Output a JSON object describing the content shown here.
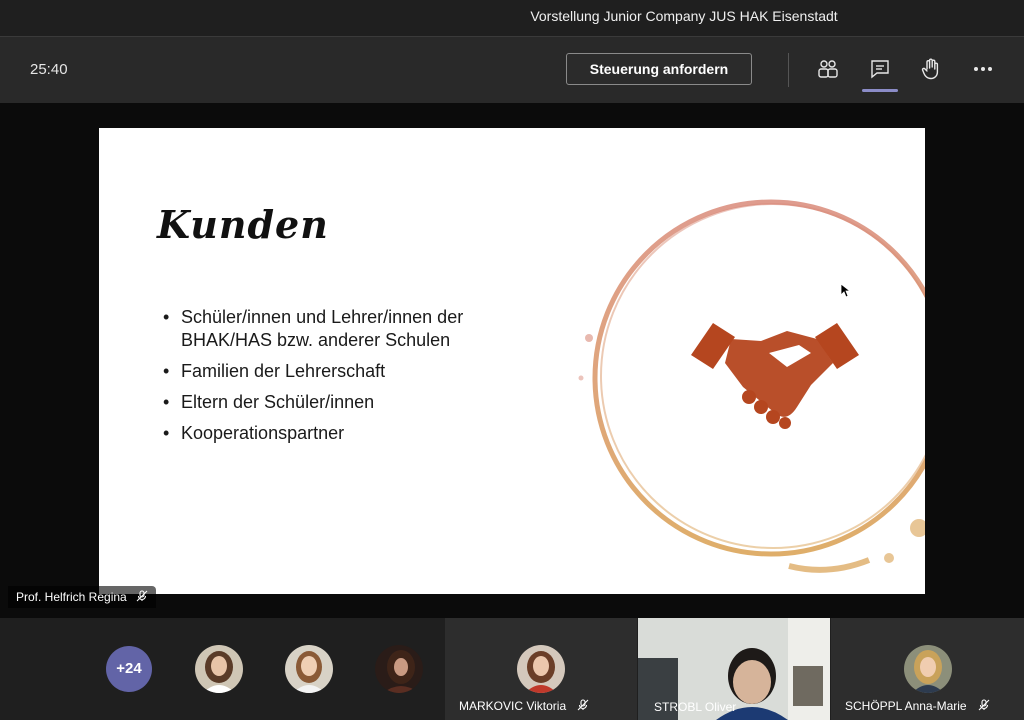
{
  "window": {
    "title": "Vorstellung Junior Company JUS HAK Eisenstadt"
  },
  "toolbar": {
    "timer": "25:40",
    "request_control_label": "Steuerung anfordern",
    "icons": [
      "participants-icon",
      "chat-icon",
      "raise-hand-icon",
      "more-options-icon"
    ]
  },
  "slide": {
    "title": "Kunden",
    "bullets": [
      "Schüler/innen und Lehrer/innen der BHAK/HAS bzw. anderer Schulen",
      "Familien der Lehrerschaft",
      "Eltern der Schüler/innen",
      "Kooperationspartner"
    ],
    "image": "handshake-icon"
  },
  "presenter": {
    "name": "Prof. Helfrich Regina",
    "muted": true
  },
  "participants": {
    "overflow_count": "+24",
    "tiles": [
      {
        "name": "MARKOVIC Viktoria",
        "muted": true
      },
      {
        "name": "STROBL Oliver",
        "video": true
      },
      {
        "name": "SCHÖPPL Anna-Marie",
        "muted": true
      }
    ]
  },
  "colors": {
    "accent": "#6264a7",
    "handshake": "#b5461f",
    "ring_top": "#d98a7a",
    "ring_bottom": "#d9a050"
  }
}
